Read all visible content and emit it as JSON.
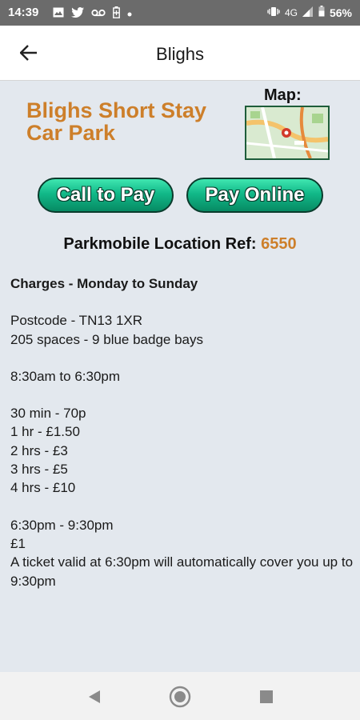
{
  "status_bar": {
    "time": "14:39",
    "network": "4G",
    "battery": "56%",
    "icons_left": [
      "image-icon",
      "twitter-icon",
      "voicemail-icon",
      "battery-saver-icon",
      "dot-icon"
    ],
    "icons_right": [
      "vibrate-icon",
      "signal-icon",
      "battery-icon"
    ]
  },
  "app_bar": {
    "title": "Blighs",
    "back_icon": "arrow-left-icon"
  },
  "car_park": {
    "name": "Blighs Short Stay Car Park",
    "map_label": "Map:"
  },
  "buttons": {
    "call_to_pay": "Call to Pay",
    "pay_online": "Pay Online"
  },
  "location_ref": {
    "label": "Parkmobile Location Ref:",
    "value": "6550"
  },
  "info": {
    "heading": "Charges - Monday to Sunday",
    "postcode": "Postcode - TN13 1XR",
    "spaces": "205 spaces - 9 blue badge bays",
    "hours": "8:30am to 6:30pm",
    "tariffs": [
      "30 min - 70p",
      "1 hr - £1.50",
      "2 hrs - £3",
      "3 hrs - £5",
      "4 hrs - £10"
    ],
    "evening_hours": "6:30pm - 9:30pm",
    "evening_price": "£1",
    "evening_note": "A ticket valid at 6:30pm will automatically cover you up to 9:30pm"
  },
  "colors": {
    "accent": "#cd7f2a",
    "button_green": "#11b888",
    "background": "#e3e8ee"
  },
  "nav_bar": {
    "icons": [
      "back-triangle-icon",
      "home-circle-icon",
      "recents-square-icon"
    ]
  }
}
